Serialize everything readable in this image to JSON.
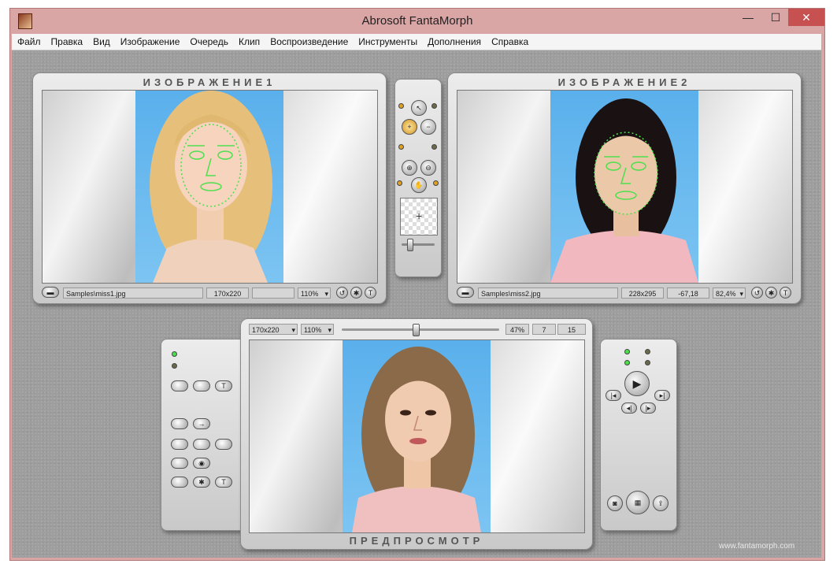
{
  "window": {
    "title": "Abrosoft FantaMorph",
    "minimize": "—",
    "maximize": "☐",
    "close": "✕"
  },
  "menu": [
    "Файл",
    "Правка",
    "Вид",
    "Изображение",
    "Очередь",
    "Клип",
    "Воспроизведение",
    "Инструменты",
    "Дополнения",
    "Справка"
  ],
  "image1": {
    "title": "ИЗОБРАЖЕНИЕ1",
    "path": "Samples\\miss1.jpg",
    "size": "170x220",
    "coords": "",
    "zoom": "110%",
    "zoom_arrow": "▾"
  },
  "image2": {
    "title": "ИЗОБРАЖЕНИЕ2",
    "path": "Samples\\miss2.jpg",
    "size": "228x295",
    "coords": "-67,18",
    "zoom": "82,4%",
    "zoom_arrow": "▾"
  },
  "preview": {
    "title": "ПРЕДПРОСМОТР",
    "size": "170x220",
    "zoom": "110%",
    "progress": "47%",
    "progress_value": 0.47,
    "frame": "7",
    "total_frames": "15",
    "arrow": "▾"
  },
  "watermark": "www.fantamorph.com",
  "colors": {
    "face_points": "#4ee04e",
    "photo_bg": "#5ab0ec",
    "window_frame": "#d9a5a5",
    "close_button": "#c75050"
  },
  "icons": {
    "open": "folder-open-icon",
    "undo": "undo-icon",
    "settings": "gear-icon",
    "text": "text-icon",
    "select": "arrow-pointer-icon",
    "add_point": "plus-icon",
    "remove_point": "minus-icon",
    "zoom_in": "zoom-in-icon",
    "zoom_out": "zoom-out-icon",
    "pan": "hand-icon",
    "play": "play-icon",
    "prev": "skip-back-icon",
    "next": "skip-forward-icon",
    "snapshot": "camera-icon",
    "film": "film-icon",
    "export": "export-icon"
  }
}
